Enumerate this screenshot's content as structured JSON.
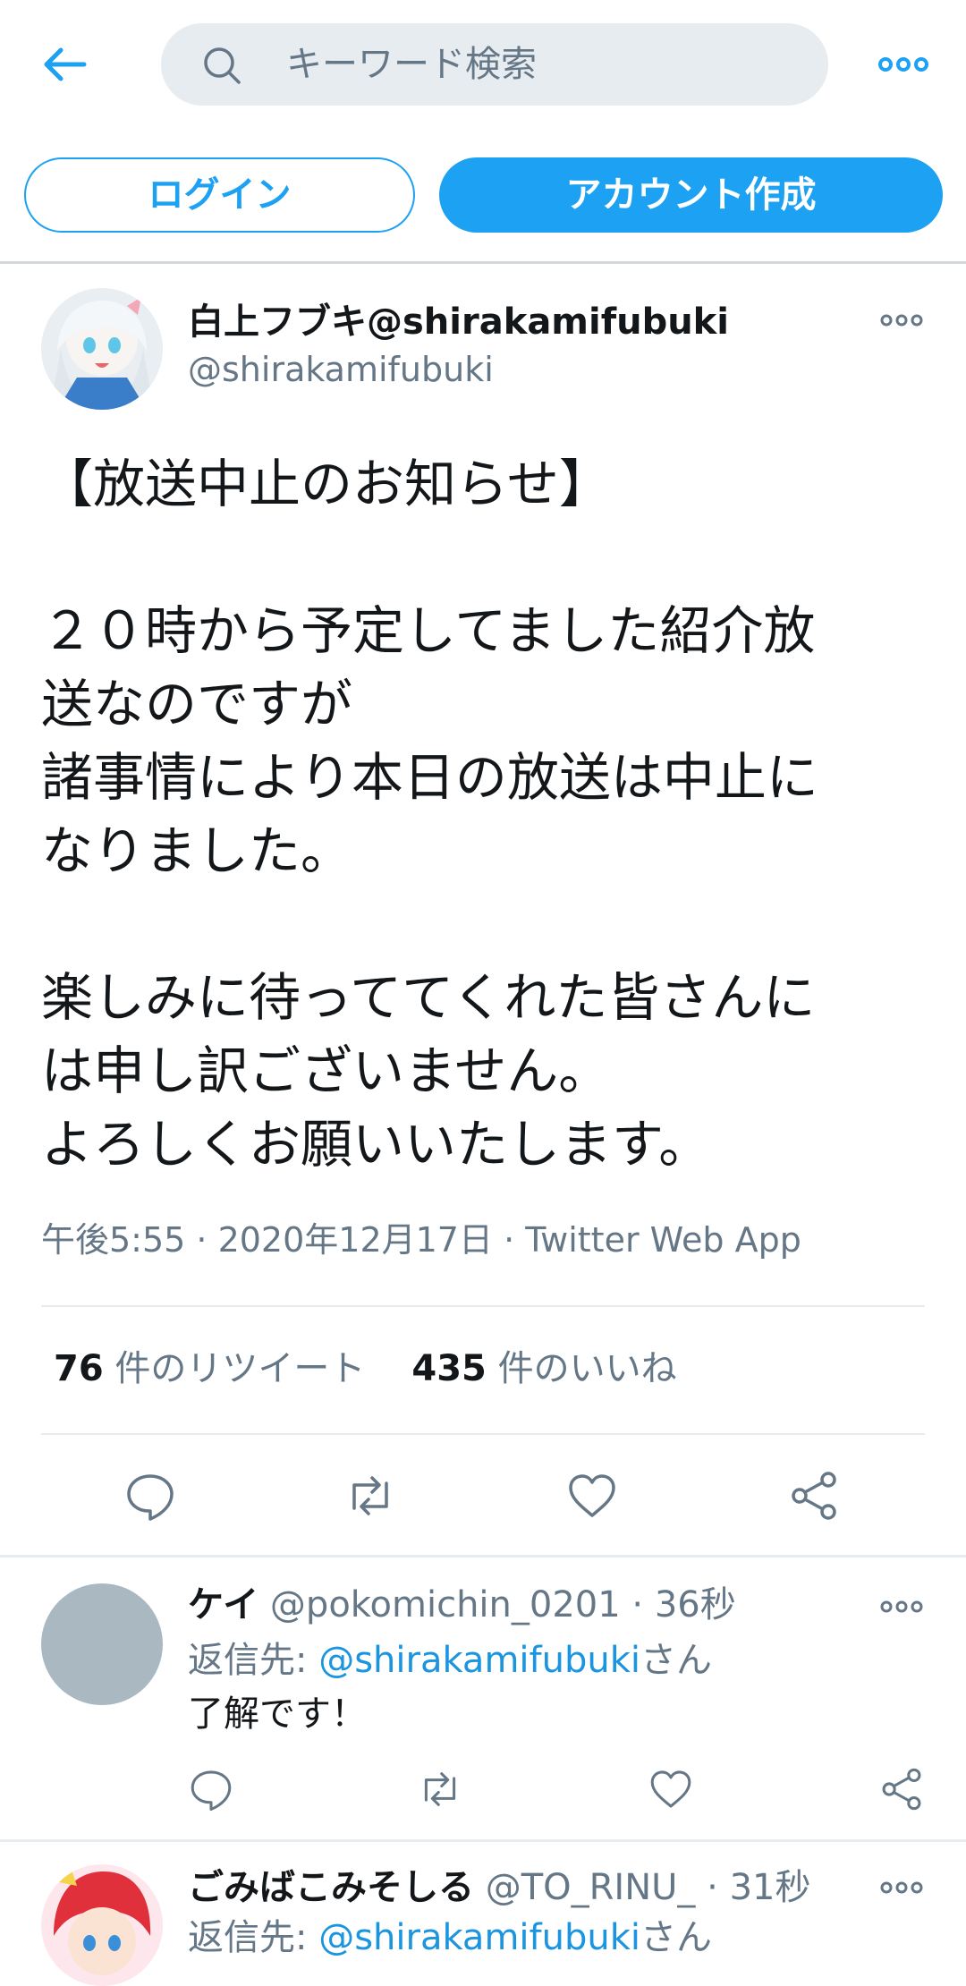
{
  "search": {
    "placeholder": "キーワード検索"
  },
  "auth": {
    "login_label": "ログイン",
    "signup_label": "アカウント作成"
  },
  "tweet": {
    "author_name": "白上フブキ@shirakamifubuki",
    "author_handle": "@shirakamifubuki",
    "text": "【放送中止のお知らせ】\n\n２０時から予定してました紹介放\n送なのですが\n諸事情により本日の放送は中止に\nなりました。\n\n楽しみに待っててくれた皆さんに\nは申し訳ございません。\nよろしくお願いいたします。",
    "meta": "午後5:55 · 2020年12月17日 · Twitter Web App",
    "retweet_count": "76",
    "retweet_label": "件のリツイート",
    "like_count": "435",
    "like_label": "件のいいね"
  },
  "replies": [
    {
      "name": "ケイ",
      "handle": "@pokomichin_0201",
      "time": "· 36秒",
      "reply_prefix": "返信先: ",
      "reply_to": "@shirakamifubuki",
      "reply_suffix": "さん",
      "text": "了解です！"
    },
    {
      "name": "ごみばこみそしる",
      "handle": "@TO_RINU_",
      "time": "· 31秒",
      "reply_prefix": "返信先: ",
      "reply_to": "@shirakamifubuki",
      "reply_suffix": "さん"
    }
  ],
  "icons": {
    "back": "arrow-left",
    "search": "magnifier",
    "more": "ellipsis",
    "reply": "speech-bubble",
    "retweet": "retweet-arrows",
    "like": "heart",
    "share": "share-nodes"
  },
  "colors": {
    "accent": "#1da1f2",
    "link": "#1b95e0",
    "muted": "#657786",
    "text": "#14171a"
  }
}
